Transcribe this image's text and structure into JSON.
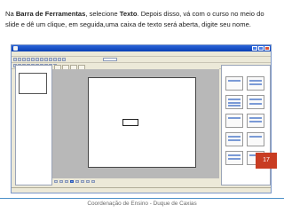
{
  "instruction": {
    "p1": "Na ",
    "bold1": "Barra de Ferramentas",
    "p2": ", selecione ",
    "bold2": "Texto",
    "p3": ". Depois disso, vá com o curso no meio do slide e dê um clique, em seguida,uma caixa de texto será aberta, digite seu nome."
  },
  "footer": {
    "text": "Coordenação de Ensino - Duque de Caxias"
  },
  "slide_number": "17",
  "colors": {
    "accent_red": "#c83c22",
    "footer_line": "#4a8fc8",
    "xp_title_blue": "#0a3fb5"
  },
  "screenshot": {
    "icon_names": [
      "app-icon",
      "minimize-icon",
      "maximize-icon",
      "close-icon",
      "toolbar-button-icon",
      "text-tool-icon"
    ]
  }
}
